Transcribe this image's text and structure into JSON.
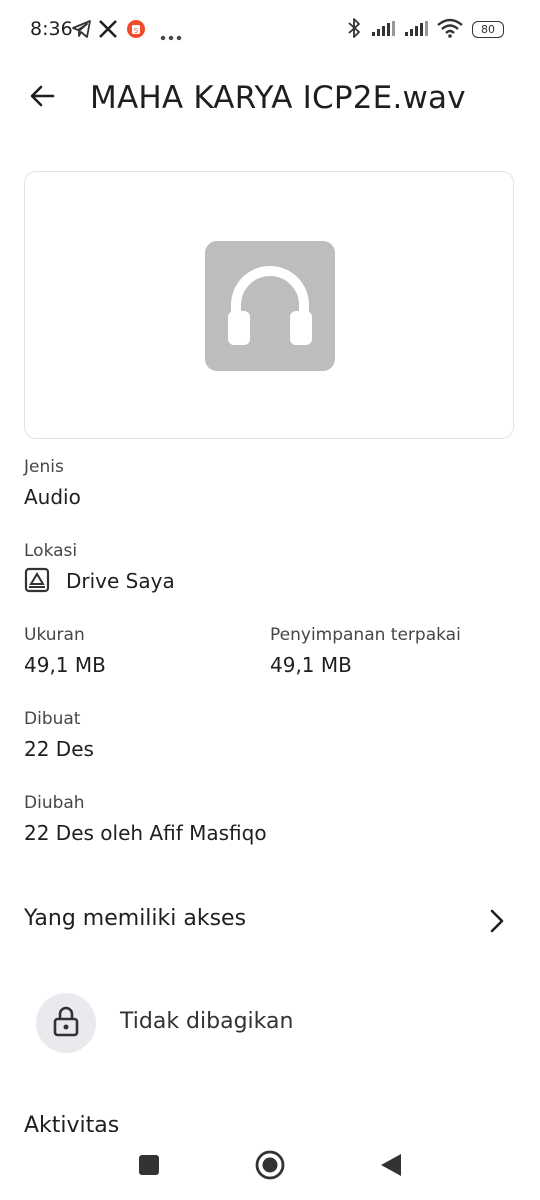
{
  "status_bar": {
    "time": "8:36",
    "battery": "80",
    "left_icons": [
      "telegram-icon",
      "x-icon",
      "shopee-icon",
      "more-dots-icon"
    ],
    "right_icons": [
      "bluetooth-icon",
      "signal-icon",
      "signal-icon",
      "wifi-icon",
      "battery-icon"
    ]
  },
  "header": {
    "title": "MAHA KARYA ICP2E.wav",
    "back_icon": "arrow-back-icon"
  },
  "preview": {
    "icon": "headphones-icon",
    "thumb_color": "#bdbdbd"
  },
  "details": {
    "type_label": "Jenis",
    "type_value": "Audio",
    "location_label": "Lokasi",
    "location_value": "Drive Saya",
    "size_label": "Ukuran",
    "size_value": "49,1 MB",
    "storage_label": "Penyimpanan terpakai",
    "storage_value": "49,1 MB",
    "created_label": "Dibuat",
    "created_value": "22 Des",
    "modified_label": "Diubah",
    "modified_value": "22 Des oleh Afif Masfiqo"
  },
  "access": {
    "title": "Yang memiliki akses",
    "status": "Tidak dibagikan"
  },
  "activity": {
    "title": "Aktivitas"
  }
}
